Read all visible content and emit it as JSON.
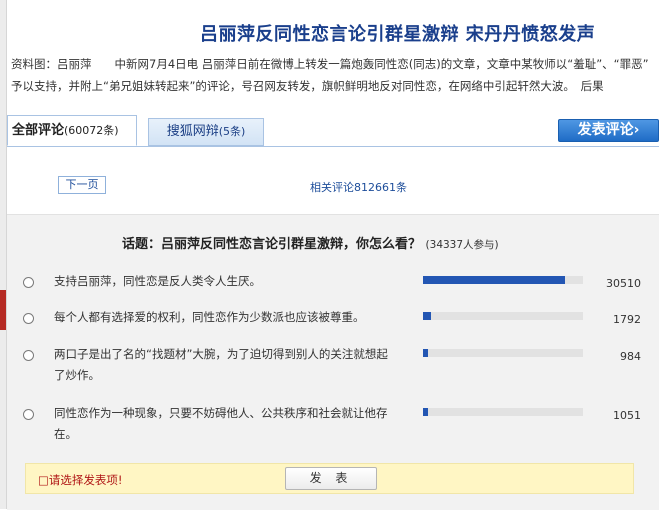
{
  "article": {
    "headline": "吕丽萍反同性恋言论引群星激辩 宋丹丹愤怒发声",
    "summary_line1": "资料图：吕丽萍　　中新网7月4日电 吕丽萍日前在微博上转发一篇炮轰同性恋(同志)的文章，文章中某牧师以“羞耻”、“罪恶”",
    "summary_line2": "予以支持，并附上“弟兄姐妹转起来”的评论，号召网友转发，旗帜鲜明地反对同性恋，在网络中引起轩然大波。　后果"
  },
  "tabs": {
    "all": {
      "label": "全部评论",
      "count": "(60072条)"
    },
    "sohu": {
      "label": "搜狐网辩",
      "count": "(5条)"
    }
  },
  "post_comment_label": "发表评论›",
  "pagination": {
    "next_page_label": "下一页",
    "related_comments": "相关评论812661条"
  },
  "poll": {
    "title": "话题：吕丽萍反同性恋言论引群星激辩，你怎么看？",
    "participants": "(34337人参与)",
    "options": [
      {
        "text": "支持吕丽萍，同性恋是反人类令人生厌。",
        "count": "30510",
        "share": 0.888
      },
      {
        "text": "每个人都有选择爱的权利，同性恋作为少数派也应该被尊重。",
        "count": "1792",
        "share": 0.052
      },
      {
        "text": "两口子是出了名的“找题材”大腕，为了迫切得到别人的关注就想起了炒作。",
        "count": "984",
        "share": 0.029
      },
      {
        "text": "同性恋作为一种现象，只要不妨碍他人、公共秩序和社会就让他存在。",
        "count": "1051",
        "share": 0.031
      }
    ],
    "notice": "□请选择发表项!",
    "submit_label": "发 表"
  },
  "colors": {
    "accent": "#1a3f8c",
    "bar_fill": "#2356b3",
    "notice_bg": "#fff6c4",
    "notice_text": "#b01616"
  }
}
